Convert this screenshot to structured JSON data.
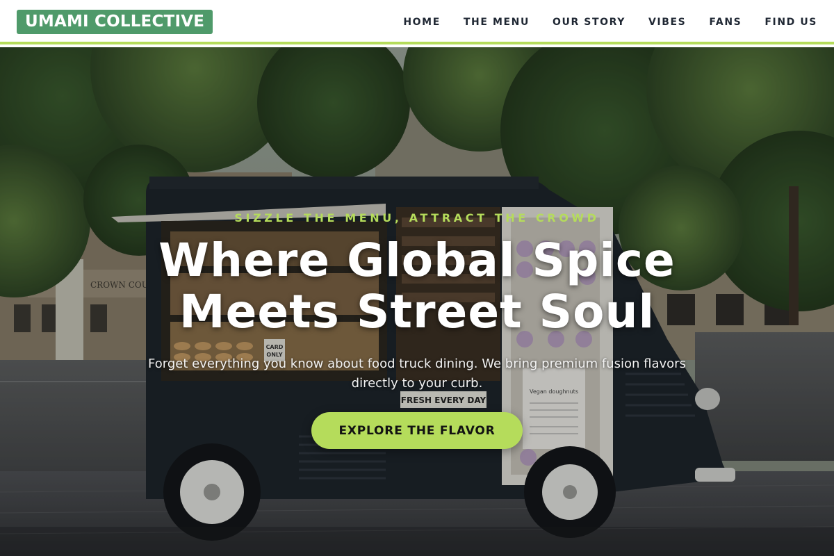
{
  "header": {
    "logo": "UMAMI COLLECTIVE",
    "nav": [
      {
        "label": "HOME"
      },
      {
        "label": "THE MENU"
      },
      {
        "label": "OUR STORY"
      },
      {
        "label": "VIBES"
      },
      {
        "label": "FANS"
      },
      {
        "label": "FIND US"
      }
    ]
  },
  "hero": {
    "tagline": "SIZZLE THE MENU, ATTRACT THE CROWD",
    "headline_line1": "Where Global Spice",
    "headline_line2": "Meets Street Soul",
    "subtext": "Forget everything you know about food truck dining. We bring premium fusion flavors directly to your curb.",
    "cta_label": "EXPLORE THE FLAVOR",
    "photo_signs": {
      "building_sign": "CROWN COU",
      "card_sign_line1": "CARD",
      "card_sign_line2": "ONLY",
      "fresh_sign": "FRESH EVERY DAY",
      "menu_board_title": "Vegan doughnuts"
    }
  },
  "colors": {
    "accent": "#b5dc5b",
    "logo_bg": "#4f9a6a",
    "nav_text": "#1f2733",
    "headline": "#ffffff"
  }
}
